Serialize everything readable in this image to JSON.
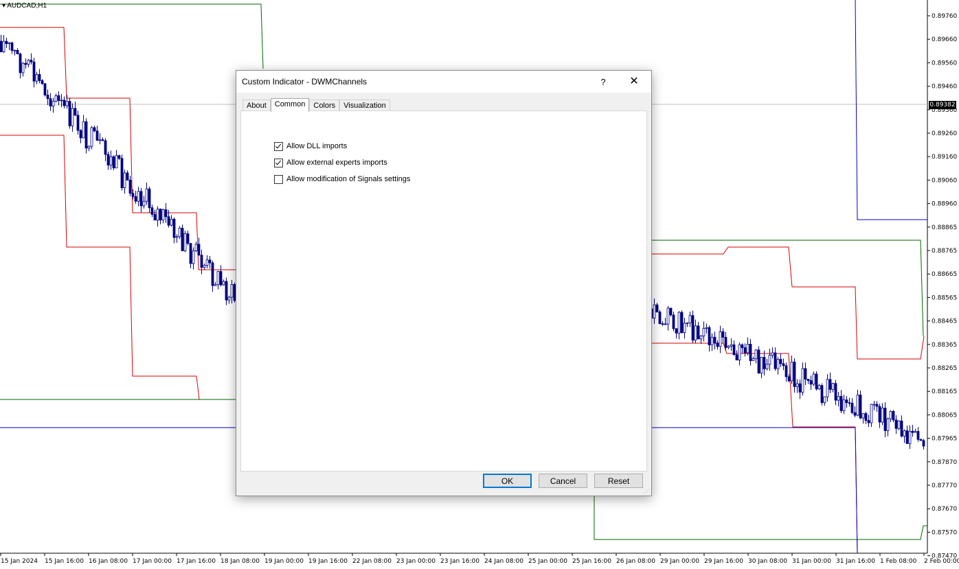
{
  "chart": {
    "symbol": "AUDCAD,H1",
    "current_price": "0.89382",
    "price_levels": [
      "0.89760",
      "0.89660",
      "0.89560",
      "0.89460",
      "0.89360",
      "0.89260",
      "0.89160",
      "0.89060",
      "0.88960",
      "0.88865",
      "0.88765",
      "0.88665",
      "0.88565",
      "0.88465",
      "0.88365",
      "0.88265",
      "0.88165",
      "0.88065",
      "0.87965",
      "0.87870",
      "0.87770",
      "0.87670",
      "0.87570",
      "0.87470"
    ],
    "time_labels": [
      "15 Jan 2024",
      "15 Jan 16:00",
      "16 Jan 08:00",
      "17 Jan 00:00",
      "17 Jan 16:00",
      "18 Jan 08:00",
      "19 Jan 00:00",
      "19 Jan 16:00",
      "22 Jan 08:00",
      "23 Jan 00:00",
      "23 Jan 16:00",
      "24 Jan 08:00",
      "25 Jan 00:00",
      "25 Jan 16:00",
      "26 Jan 08:00",
      "29 Jan 00:00",
      "29 Jan 16:00",
      "30 Jan 08:00",
      "31 Jan 00:00",
      "31 Jan 16:00",
      "1 Feb 08:00",
      "2 Feb 00:00"
    ],
    "colors": {
      "daily": "#d40000",
      "weekly": "#006400",
      "monthly": "#0000c8",
      "candle": "#000080",
      "background": "#ffffff"
    }
  },
  "dialog": {
    "title": "Custom Indicator - DWMChannels",
    "help": "?",
    "close": "✕",
    "tabs": [
      "About",
      "Common",
      "Colors",
      "Visualization"
    ],
    "active_tab": "Common",
    "options": [
      {
        "label": "Allow DLL imports",
        "checked": true
      },
      {
        "label": "Allow external experts imports",
        "checked": true
      },
      {
        "label": "Allow modification of Signals settings",
        "checked": false
      }
    ],
    "buttons": {
      "ok": "OK",
      "cancel": "Cancel",
      "reset": "Reset"
    }
  }
}
